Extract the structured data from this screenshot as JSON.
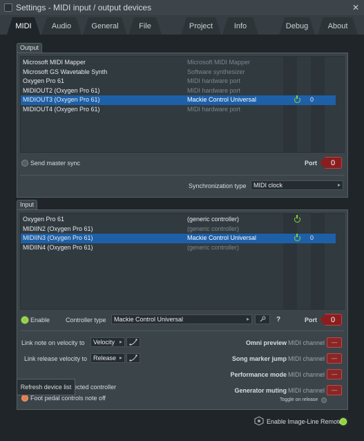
{
  "window": {
    "title": "Settings - MIDI input / output devices",
    "close_glyph": "✕"
  },
  "tabs": [
    {
      "label": "MIDI",
      "active": true
    },
    {
      "label": "Audio"
    },
    {
      "label": "General"
    },
    {
      "label": "File"
    },
    {
      "label": "Project"
    },
    {
      "label": "Info"
    },
    {
      "label": "Debug"
    },
    {
      "label": "About"
    }
  ],
  "output": {
    "group_label": "Output",
    "rows": [
      {
        "name": "Microsoft MIDI Mapper",
        "desc": "Microsoft MIDI Mapper",
        "enabled": false,
        "port": ""
      },
      {
        "name": "Microsoft GS Wavetable Synth",
        "desc": "Software synthesizer",
        "enabled": false,
        "port": ""
      },
      {
        "name": "Oxygen Pro 61",
        "desc": "MIDI hardware port",
        "enabled": false,
        "port": ""
      },
      {
        "name": "MIDIOUT2 (Oxygen Pro 61)",
        "desc": "MIDI hardware port",
        "enabled": false,
        "port": ""
      },
      {
        "name": "MIDIOUT3 (Oxygen Pro 61)",
        "desc": "Mackie Control Universal",
        "enabled": true,
        "port": "0",
        "selected": true
      },
      {
        "name": "MIDIOUT4 (Oxygen Pro 61)",
        "desc": "MIDI hardware port",
        "enabled": false,
        "port": ""
      }
    ],
    "send_master_sync": "Send master sync",
    "port_label": "Port",
    "port_value": "0",
    "sync_type_label": "Synchronization type",
    "sync_type_value": "MIDI clock"
  },
  "input": {
    "group_label": "Input",
    "rows": [
      {
        "name": "Oxygen Pro 61",
        "desc": "(generic controller)",
        "enabled": true,
        "port": ""
      },
      {
        "name": "MIDIIN2 (Oxygen Pro 61)",
        "desc": "(generic controller)",
        "enabled": false,
        "port": ""
      },
      {
        "name": "MIDIIN3 (Oxygen Pro 61)",
        "desc": "Mackie Control Universal",
        "enabled": true,
        "port": "0",
        "selected": true
      },
      {
        "name": "MIDIIN4 (Oxygen Pro 61)",
        "desc": "(generic controller)",
        "enabled": false,
        "port": ""
      }
    ],
    "enable_label": "Enable",
    "controller_type_label": "Controller type",
    "controller_type_value": "Mackie Control Universal",
    "help_glyph": "?",
    "port_label": "Port",
    "port_value": "0"
  },
  "options": {
    "link_note_velocity_label": "Link note on velocity to",
    "link_note_velocity_value": "Velocity",
    "link_release_velocity_label": "Link release velocity to",
    "link_release_velocity_value": "Release",
    "auto_accept": "Auto accept detected controller",
    "foot_pedal": "Foot pedal controls note off"
  },
  "midi_channels": {
    "channel_suffix": "MIDI channel",
    "btn_label": "---",
    "items": [
      {
        "label": "Omni preview"
      },
      {
        "label": "Song marker jump"
      },
      {
        "label": "Performance mode"
      },
      {
        "label": "Generator muting"
      }
    ],
    "toggle_on_release": "Toggle on release"
  },
  "footer": {
    "refresh_label": "Refresh device list",
    "image_line_remote": "Enable Image-Line Remote"
  },
  "colors": {
    "accent_selection": "#1e60a8",
    "power_green": "#8fd33b",
    "port_red": "#8a1e1e"
  }
}
